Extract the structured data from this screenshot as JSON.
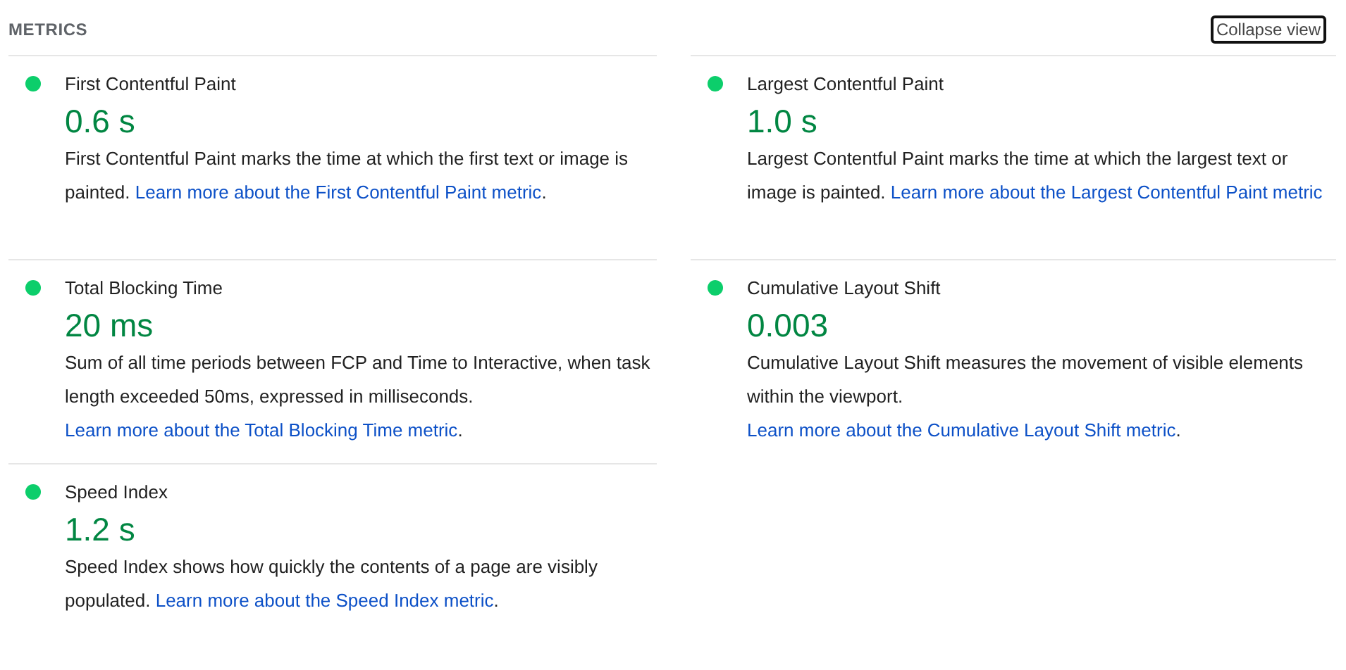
{
  "header": {
    "title": "METRICS",
    "toggle": "Collapse view"
  },
  "metrics": [
    {
      "title": "First Contentful Paint",
      "color": "#0cce6b",
      "value": "0.6 s",
      "description": "First Contentful Paint marks the time at which the first text or image is painted.",
      "link": "Learn more about the First Contentful Paint metric",
      "suffix": "."
    },
    {
      "title": "Largest Contentful Paint",
      "color": "#0cce6b",
      "value": "1.0 s",
      "description": "Largest Contentful Paint marks the time at which the largest text or image is painted.",
      "link": "Learn more about the Largest Contentful Paint metric"
    },
    {
      "title": "Total Blocking Time",
      "color": "#0cce6b",
      "value": "20 ms",
      "description": "Sum of all time periods between FCP and Time to Interactive, when task length exceeded 50ms, expressed in milliseconds.",
      "link": "Learn more about the Total Blocking Time metric",
      "suffix": "."
    },
    {
      "title": "Cumulative Layout Shift",
      "color": "#0cce6b",
      "value": "0.003",
      "description": "Cumulative Layout Shift measures the movement of visible elements within the viewport.",
      "link": "Learn more about the Cumulative Layout Shift metric",
      "suffix": "."
    },
    {
      "title": "Speed Index",
      "color": "#0cce6b",
      "value": "1.2 s",
      "description": "Speed Index shows how quickly the contents of a page are visibly populated.",
      "link": "Learn more about the Speed Index metric",
      "suffix": "."
    }
  ]
}
